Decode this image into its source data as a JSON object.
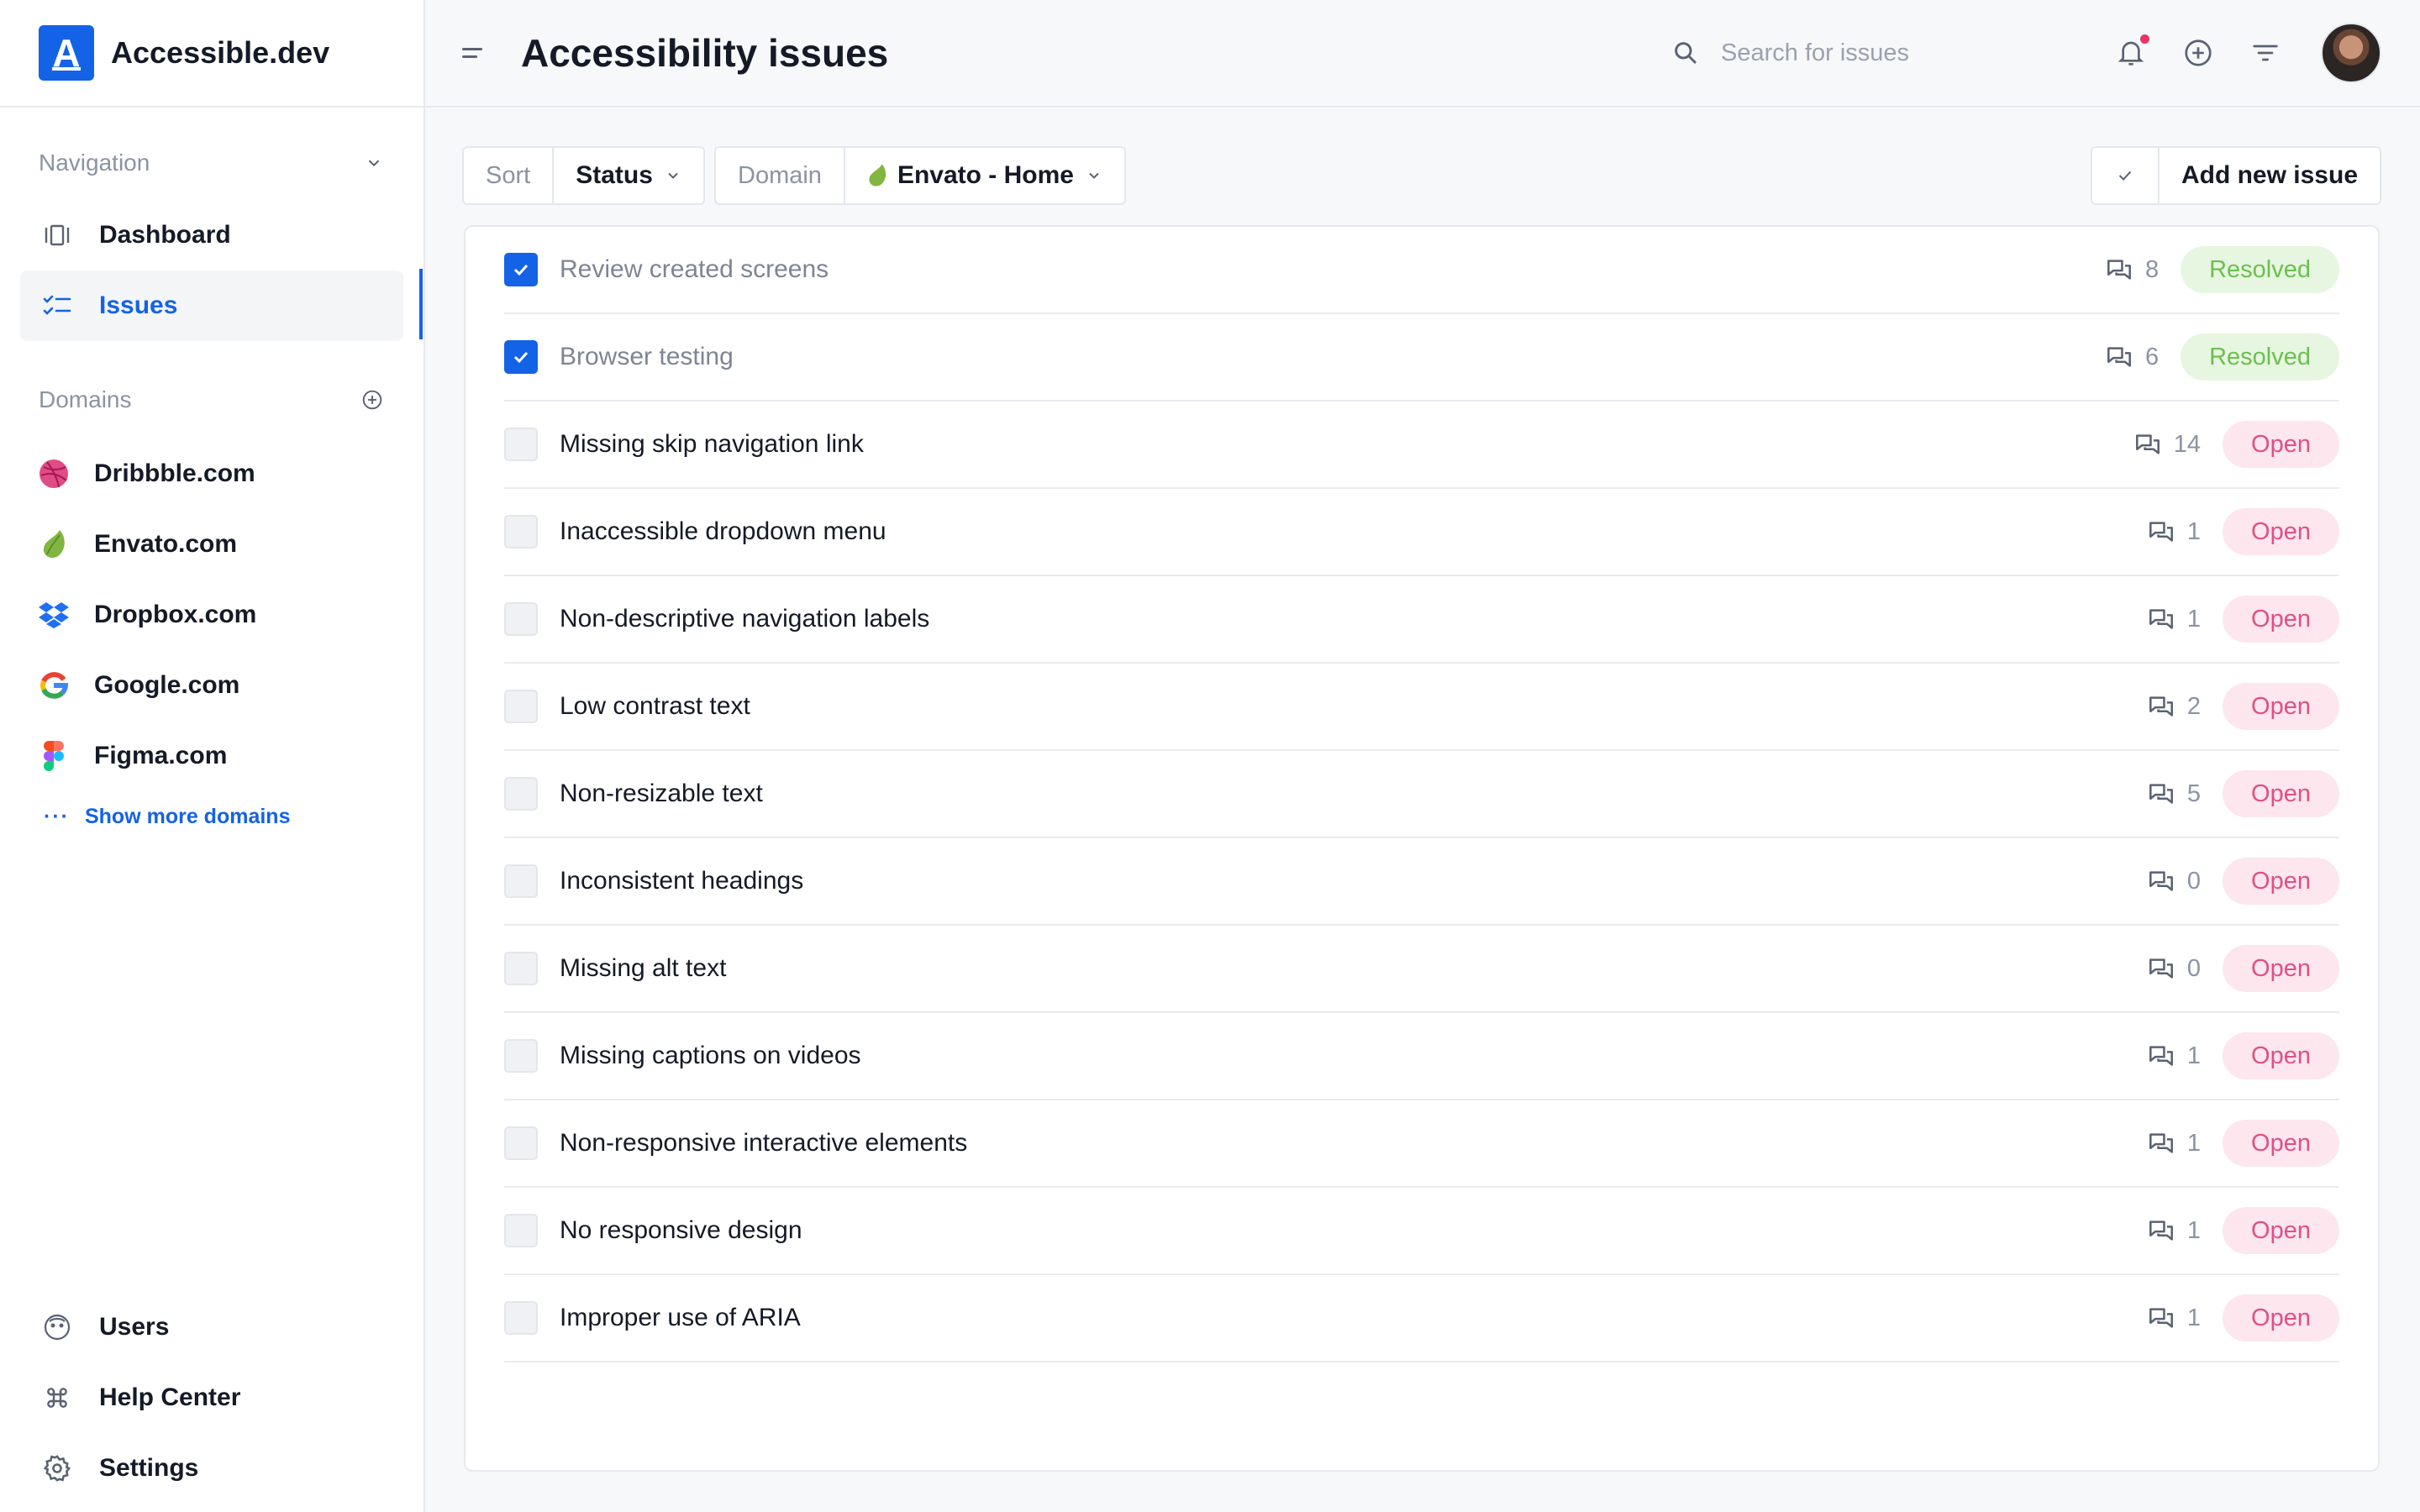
{
  "brand": {
    "logo_letter": "A",
    "name": "Accessible.dev"
  },
  "sidebar": {
    "nav_heading": "Navigation",
    "nav_items": [
      {
        "label": "Dashboard",
        "icon": "dashboard-icon",
        "active": false
      },
      {
        "label": "Issues",
        "icon": "checklist-icon",
        "active": true
      }
    ],
    "domains_heading": "Domains",
    "domains": [
      {
        "label": "Dribbble.com",
        "icon": "dribbble-icon"
      },
      {
        "label": "Envato.com",
        "icon": "envato-icon"
      },
      {
        "label": "Dropbox.com",
        "icon": "dropbox-icon"
      },
      {
        "label": "Google.com",
        "icon": "google-icon"
      },
      {
        "label": "Figma.com",
        "icon": "figma-icon"
      }
    ],
    "show_more": "Show more domains",
    "bottom_items": [
      {
        "label": "Users",
        "icon": "users-icon"
      },
      {
        "label": "Help Center",
        "icon": "command-icon"
      },
      {
        "label": "Settings",
        "icon": "gear-icon"
      }
    ]
  },
  "header": {
    "title": "Accessibility issues",
    "search_placeholder": "Search for issues",
    "has_notification": true
  },
  "toolbar": {
    "sort_label": "Sort",
    "sort_value": "Status",
    "domain_label": "Domain",
    "domain_value": "Envato - Home",
    "add_label": "Add new issue"
  },
  "issues": [
    {
      "title": "Review created screens",
      "comments": "8",
      "status": "Resolved",
      "checked": true
    },
    {
      "title": "Browser testing",
      "comments": "6",
      "status": "Resolved",
      "checked": true
    },
    {
      "title": "Missing skip navigation link",
      "comments": "14",
      "status": "Open",
      "checked": false
    },
    {
      "title": "Inaccessible dropdown menu",
      "comments": "1",
      "status": "Open",
      "checked": false
    },
    {
      "title": "Non-descriptive navigation labels",
      "comments": "1",
      "status": "Open",
      "checked": false
    },
    {
      "title": "Low contrast text",
      "comments": "2",
      "status": "Open",
      "checked": false
    },
    {
      "title": "Non-resizable text",
      "comments": "5",
      "status": "Open",
      "checked": false
    },
    {
      "title": "Inconsistent headings",
      "comments": "0",
      "status": "Open",
      "checked": false
    },
    {
      "title": "Missing alt text",
      "comments": "0",
      "status": "Open",
      "checked": false
    },
    {
      "title": "Missing captions on videos",
      "comments": "1",
      "status": "Open",
      "checked": false
    },
    {
      "title": "Non-responsive interactive elements",
      "comments": "1",
      "status": "Open",
      "checked": false
    },
    {
      "title": "No responsive design",
      "comments": "1",
      "status": "Open",
      "checked": false
    },
    {
      "title": "Improper use of ARIA",
      "comments": "1",
      "status": "Open",
      "checked": false
    }
  ],
  "colors": {
    "accent": "#1463e6",
    "resolved_bg": "#e6f6e0",
    "resolved_text": "#6cbf4f",
    "open_bg": "#fde6ee",
    "open_text": "#e14f86",
    "notification": "#e8336a"
  }
}
